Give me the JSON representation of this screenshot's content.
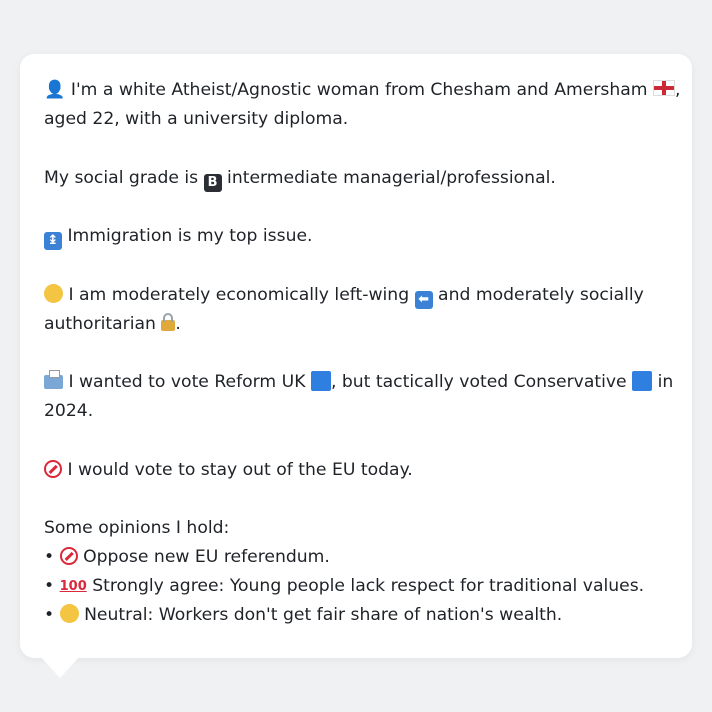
{
  "profile": {
    "line1_a": " I'm a white Atheist/Agnostic woman from Chesham and Amersham ",
    "line1_b": ",",
    "line2": "aged 22, with a university diploma.",
    "social_prefix": "My social grade is ",
    "social_grade_badge": "B",
    "social_suffix": " intermediate managerial/professional.",
    "top_issue": " Immigration is my top issue.",
    "ideology_a": " I am moderately economically left-wing ",
    "ideology_b": " and moderately socially",
    "ideology_c": "authoritarian ",
    "ideology_d": ".",
    "vote_a": " I wanted to vote Reform UK ",
    "vote_b": ", but tactically voted Conservative ",
    "vote_c": " in",
    "vote_d": "2024.",
    "eu_stance": " I would vote to stay out of the EU today.",
    "opinions_heading": "Some opinions I hold:",
    "opinions": [
      {
        "bullet": "•",
        "text": " Oppose new EU referendum."
      },
      {
        "bullet": "•",
        "text": " Strongly agree: Young people lack respect for traditional values."
      },
      {
        "bullet": "•",
        "text": " Neutral: Workers don't get fair share of nation's wealth."
      }
    ]
  },
  "icons": {
    "person": "bust-in-silhouette-icon",
    "flag": "england-flag-icon",
    "grade": "b-button-icon",
    "immigration": "passport-control-icon",
    "thinking": "thinking-face-icon",
    "left_arrow": "left-arrow-icon",
    "lock": "locked-icon",
    "ballot": "ballot-box-icon",
    "reform_square": "blue-square-icon",
    "conservative_square": "blue-square-icon",
    "no_entry": "prohibited-icon",
    "hundred": "hundred-points-icon",
    "neutral": "neutral-face-icon"
  },
  "colors": {
    "background": "#f0f1f3",
    "card": "#ffffff",
    "text": "#1f2328",
    "party_blue": "#2f7fe0",
    "prohibited_red": "#d9293a"
  }
}
